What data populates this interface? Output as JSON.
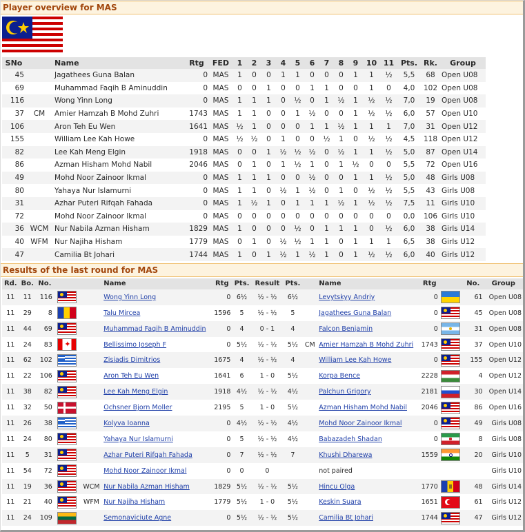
{
  "overview": {
    "title": "Player overview for MAS",
    "flag": "malaysia-flag",
    "headers": [
      "SNo",
      "",
      "Name",
      "Rtg",
      "FED",
      "1",
      "2",
      "3",
      "4",
      "5",
      "6",
      "7",
      "8",
      "9",
      "10",
      "11",
      "Pts.",
      "Rk.",
      "Group"
    ],
    "rows": [
      [
        "45",
        "",
        "Jagathees Guna Balan",
        "0",
        "MAS",
        "1",
        "0",
        "0",
        "1",
        "1",
        "0",
        "0",
        "0",
        "1",
        "1",
        "½",
        "5,5",
        "68",
        "Open U08"
      ],
      [
        "69",
        "",
        "Muhammad Faqih B Aminuddin",
        "0",
        "MAS",
        "0",
        "0",
        "1",
        "0",
        "0",
        "1",
        "1",
        "0",
        "0",
        "1",
        "0",
        "4,0",
        "102",
        "Open U08"
      ],
      [
        "116",
        "",
        "Wong Yinn Long",
        "0",
        "MAS",
        "1",
        "1",
        "1",
        "0",
        "½",
        "0",
        "1",
        "½",
        "1",
        "½",
        "½",
        "7,0",
        "19",
        "Open U08"
      ],
      [
        "37",
        "CM",
        "Amier Hamzah B Mohd Zuhri",
        "1743",
        "MAS",
        "1",
        "1",
        "0",
        "0",
        "1",
        "½",
        "0",
        "0",
        "1",
        "½",
        "½",
        "6,0",
        "57",
        "Open U10"
      ],
      [
        "106",
        "",
        "Aron Teh Eu Wen",
        "1641",
        "MAS",
        "½",
        "1",
        "0",
        "0",
        "0",
        "1",
        "1",
        "½",
        "1",
        "1",
        "1",
        "7,0",
        "31",
        "Open U12"
      ],
      [
        "155",
        "",
        "William Lee Kah Howe",
        "0",
        "MAS",
        "½",
        "½",
        "0",
        "1",
        "0",
        "0",
        "½",
        "1",
        "0",
        "½",
        "½",
        "4,5",
        "118",
        "Open U12"
      ],
      [
        "82",
        "",
        "Lee Kah Meng Elgin",
        "1918",
        "MAS",
        "0",
        "0",
        "1",
        "½",
        "½",
        "½",
        "0",
        "½",
        "1",
        "1",
        "½",
        "5,0",
        "87",
        "Open U14"
      ],
      [
        "86",
        "",
        "Azman Hisham Mohd Nabil",
        "2046",
        "MAS",
        "0",
        "1",
        "0",
        "1",
        "½",
        "1",
        "0",
        "1",
        "½",
        "0",
        "0",
        "5,5",
        "72",
        "Open U16"
      ],
      [
        "49",
        "",
        "Mohd Noor Zainoor Ikmal",
        "0",
        "MAS",
        "1",
        "1",
        "1",
        "0",
        "0",
        "½",
        "0",
        "0",
        "1",
        "1",
        "½",
        "5,0",
        "48",
        "Girls U08"
      ],
      [
        "80",
        "",
        "Yahaya Nur Islamurni",
        "0",
        "MAS",
        "1",
        "1",
        "0",
        "½",
        "1",
        "½",
        "0",
        "1",
        "0",
        "½",
        "½",
        "5,5",
        "43",
        "Girls U08"
      ],
      [
        "31",
        "",
        "Azhar Puteri Rifqah Fahada",
        "0",
        "MAS",
        "1",
        "½",
        "1",
        "0",
        "1",
        "1",
        "1",
        "½",
        "1",
        "½",
        "½",
        "7,5",
        "11",
        "Girls U10"
      ],
      [
        "72",
        "",
        "Mohd Noor Zainoor Ikmal",
        "0",
        "MAS",
        "0",
        "0",
        "0",
        "0",
        "0",
        "0",
        "0",
        "0",
        "0",
        "0",
        "0",
        "0,0",
        "106",
        "Girls U10"
      ],
      [
        "36",
        "WCM",
        "Nur Nabila Azman Hisham",
        "1829",
        "MAS",
        "1",
        "0",
        "0",
        "0",
        "½",
        "0",
        "1",
        "1",
        "1",
        "0",
        "½",
        "6,0",
        "38",
        "Girls U14"
      ],
      [
        "40",
        "WFM",
        "Nur Najiha Hisham",
        "1779",
        "MAS",
        "0",
        "1",
        "0",
        "½",
        "½",
        "1",
        "1",
        "0",
        "1",
        "1",
        "1",
        "6,5",
        "38",
        "Girls U12"
      ],
      [
        "47",
        "",
        "Camilia Bt Johari",
        "1744",
        "MAS",
        "1",
        "0",
        "1",
        "½",
        "1",
        "½",
        "1",
        "0",
        "1",
        "½",
        "½",
        "6,0",
        "40",
        "Girls U12"
      ]
    ]
  },
  "results": {
    "title": "Results of the last round for MAS",
    "headers": [
      "Rd.",
      "Bo.",
      "No.",
      "",
      "",
      "Name",
      "Rtg",
      "Pts.",
      "Result",
      "Pts.",
      "",
      "Name",
      "Rtg",
      "",
      "No.",
      "Group"
    ],
    "rows": [
      {
        "rd": "11",
        "bo": "11",
        "no": "116",
        "flag1": "my",
        "t1": "",
        "name1": "Wong Yinn Long",
        "rtg1": "0",
        "pts1": "6½",
        "result": "½ - ½",
        "pts2": "6½",
        "t2": "",
        "name2": "Levytskyy Andriy",
        "rtg2": "0",
        "flag2": "ua",
        "no2": "61",
        "group": "Open U08"
      },
      {
        "rd": "11",
        "bo": "29",
        "no": "8",
        "flag1": "ro",
        "t1": "",
        "name1": "Talu Mircea",
        "rtg1": "1596",
        "pts1": "5",
        "result": "½ - ½",
        "pts2": "5",
        "t2": "",
        "name2": "Jagathees Guna Balan",
        "rtg2": "0",
        "flag2": "my",
        "no2": "45",
        "group": "Open U08"
      },
      {
        "rd": "11",
        "bo": "44",
        "no": "69",
        "flag1": "my",
        "t1": "",
        "name1": "Muhammad Faqih B Aminuddin",
        "rtg1": "0",
        "pts1": "4",
        "result": "0 - 1",
        "pts2": "4",
        "t2": "",
        "name2": "Falcon Benjamin",
        "rtg2": "0",
        "flag2": "ar",
        "no2": "31",
        "group": "Open U08"
      },
      {
        "rd": "11",
        "bo": "24",
        "no": "83",
        "flag1": "ca",
        "t1": "",
        "name1": "Bellissimo Joseph F",
        "rtg1": "0",
        "pts1": "5½",
        "result": "½ - ½",
        "pts2": "5½",
        "t2": "CM",
        "name2": "Amier Hamzah B Mohd Zuhri",
        "rtg2": "1743",
        "flag2": "my",
        "no2": "37",
        "group": "Open U10"
      },
      {
        "rd": "11",
        "bo": "62",
        "no": "102",
        "flag1": "gr",
        "t1": "",
        "name1": "Zisiadis Dimitrios",
        "rtg1": "1675",
        "pts1": "4",
        "result": "½ - ½",
        "pts2": "4",
        "t2": "",
        "name2": "William Lee Kah Howe",
        "rtg2": "0",
        "flag2": "my",
        "no2": "155",
        "group": "Open U12"
      },
      {
        "rd": "11",
        "bo": "22",
        "no": "106",
        "flag1": "my",
        "t1": "",
        "name1": "Aron Teh Eu Wen",
        "rtg1": "1641",
        "pts1": "6",
        "result": "1 - 0",
        "pts2": "5½",
        "t2": "",
        "name2": "Korpa Bence",
        "rtg2": "2228",
        "flag2": "hu",
        "no2": "4",
        "group": "Open U12"
      },
      {
        "rd": "11",
        "bo": "38",
        "no": "82",
        "flag1": "my",
        "t1": "",
        "name1": "Lee Kah Meng Elgin",
        "rtg1": "1918",
        "pts1": "4½",
        "result": "½ - ½",
        "pts2": "4½",
        "t2": "",
        "name2": "Palchun Grigory",
        "rtg2": "2181",
        "flag2": "ru",
        "no2": "30",
        "group": "Open U14"
      },
      {
        "rd": "11",
        "bo": "32",
        "no": "50",
        "flag1": "dk",
        "t1": "",
        "name1": "Ochsner Bjorn Moller",
        "rtg1": "2195",
        "pts1": "5",
        "result": "1 - 0",
        "pts2": "5½",
        "t2": "",
        "name2": "Azman Hisham Mohd Nabil",
        "rtg2": "2046",
        "flag2": "my",
        "no2": "86",
        "group": "Open U16"
      },
      {
        "rd": "11",
        "bo": "26",
        "no": "38",
        "flag1": "gr",
        "t1": "",
        "name1": "Kolyva Ioanna",
        "rtg1": "0",
        "pts1": "4½",
        "result": "½ - ½",
        "pts2": "4½",
        "t2": "",
        "name2": "Mohd Noor Zainoor Ikmal",
        "rtg2": "0",
        "flag2": "my",
        "no2": "49",
        "group": "Girls U08"
      },
      {
        "rd": "11",
        "bo": "24",
        "no": "80",
        "flag1": "my",
        "t1": "",
        "name1": "Yahaya Nur Islamurni",
        "rtg1": "0",
        "pts1": "5",
        "result": "½ - ½",
        "pts2": "4½",
        "t2": "",
        "name2": "Babazadeh Shadan",
        "rtg2": "0",
        "flag2": "ir",
        "no2": "8",
        "group": "Girls U08"
      },
      {
        "rd": "11",
        "bo": "5",
        "no": "31",
        "flag1": "my",
        "t1": "",
        "name1": "Azhar Puteri Rifqah Fahada",
        "rtg1": "0",
        "pts1": "7",
        "result": "½ - ½",
        "pts2": "7",
        "t2": "",
        "name2": "Khushi Dharewa",
        "rtg2": "1559",
        "flag2": "in",
        "no2": "20",
        "group": "Girls U10"
      },
      {
        "rd": "11",
        "bo": "54",
        "no": "72",
        "flag1": "my",
        "t1": "",
        "name1": "Mohd Noor Zainoor Ikmal",
        "rtg1": "0",
        "pts1": "0",
        "result": "0",
        "pts2": "",
        "t2": "",
        "name2": "not paired",
        "rtg2": "",
        "flag2": "",
        "no2": "",
        "group": "Girls U10",
        "unpaired": true
      },
      {
        "rd": "11",
        "bo": "19",
        "no": "36",
        "flag1": "my",
        "t1": "WCM",
        "name1": "Nur Nabila Azman Hisham",
        "rtg1": "1829",
        "pts1": "5½",
        "result": "½ - ½",
        "pts2": "5½",
        "t2": "",
        "name2": "Hincu Olga",
        "rtg2": "1770",
        "flag2": "md",
        "no2": "48",
        "group": "Girls U14"
      },
      {
        "rd": "11",
        "bo": "21",
        "no": "40",
        "flag1": "my",
        "t1": "WFM",
        "name1": "Nur Najiha Hisham",
        "rtg1": "1779",
        "pts1": "5½",
        "result": "1 - 0",
        "pts2": "5½",
        "t2": "",
        "name2": "Keskin Suara",
        "rtg2": "1651",
        "flag2": "tr",
        "no2": "61",
        "group": "Girls U12"
      },
      {
        "rd": "11",
        "bo": "24",
        "no": "109",
        "flag1": "lt",
        "t1": "",
        "name1": "Semonaviciute Agne",
        "rtg1": "0",
        "pts1": "5½",
        "result": "½ - ½",
        "pts2": "5½",
        "t2": "",
        "name2": "Camilia Bt Johari",
        "rtg2": "1744",
        "flag2": "my",
        "no2": "47",
        "group": "Girls U12"
      }
    ]
  }
}
